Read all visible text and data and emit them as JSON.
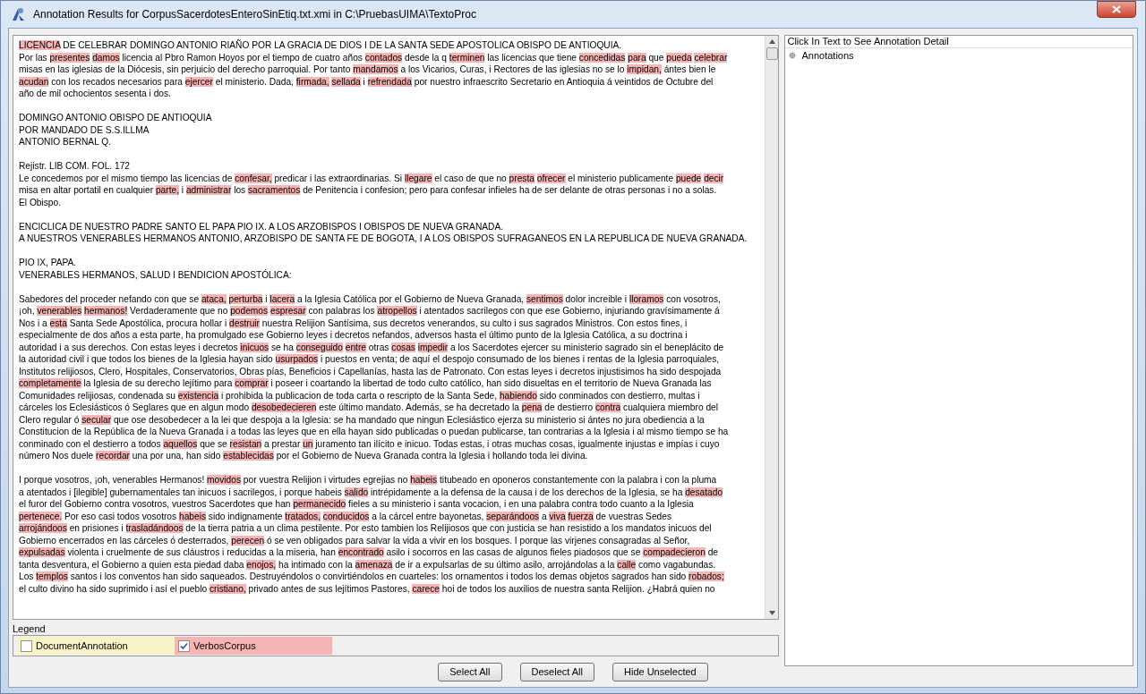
{
  "window": {
    "title": "Annotation Results for CorpusSacerdotesEnteroSinEtiq.txt.xmi in C:\\PruebasUIMA\\TextoProc"
  },
  "document": {
    "paragraphs": [
      {
        "lines": [
          [
            {
              "text": "LICENCIA",
              "annotated": true
            },
            {
              "text": " DE CELEBRAR DOMINGO ANTONIO RIAÑO POR LA GRACIA DE DIOS I DE LA SANTA SEDE APOSTOLICA OBISPO DE ANTIOQUIA.",
              "annotated": false
            }
          ],
          [
            {
              "text": "Por las ",
              "annotated": false
            },
            {
              "text": "presentes",
              "annotated": true
            },
            {
              "text": "damos",
              "annotated": true
            },
            {
              "text": " licencia al Pbro Ramon Hoyos por el tiempo de cuatro años ",
              "annotated": false
            },
            {
              "text": "contados",
              "annotated": true
            },
            {
              "text": " desde la q ",
              "annotated": false
            },
            {
              "text": "terminen",
              "annotated": true
            },
            {
              "text": " las licencias que tiene ",
              "annotated": false
            },
            {
              "text": "concedidas",
              "annotated": true
            },
            {
              "text": "para",
              "annotated": true
            },
            {
              "text": " que ",
              "annotated": false
            },
            {
              "text": "pueda",
              "annotated": true
            },
            {
              "text": "celebrar",
              "annotated": true
            }
          ],
          [
            {
              "text": "misas en las iglesias de la Diócesis, sin perjuicio del derecho parroquial. Por tanto ",
              "annotated": false
            },
            {
              "text": "mandamos",
              "annotated": true
            },
            {
              "text": " a los Vicarios, Curas, i Rectores de las iglesias no se lo ",
              "annotated": false
            },
            {
              "text": "impidan,",
              "annotated": true
            },
            {
              "text": " ántes bien le",
              "annotated": false
            }
          ],
          [
            {
              "text": "acudan",
              "annotated": true
            },
            {
              "text": " con los recados necesarios para ",
              "annotated": false
            },
            {
              "text": "ejercer",
              "annotated": true
            },
            {
              "text": " el ministerio. Dada, ",
              "annotated": false
            },
            {
              "text": "firmada,",
              "annotated": true
            },
            {
              "text": "sellada",
              "annotated": true
            },
            {
              "text": " i ",
              "annotated": false
            },
            {
              "text": "refrendada",
              "annotated": true
            },
            {
              "text": " por nuestro infraescrito Secretario en Antioquia á veintidos de Octubre del",
              "annotated": false
            }
          ],
          [
            {
              "text": "año de mil ochocientos sesenta i dos.",
              "annotated": false
            }
          ]
        ]
      },
      {
        "lines": [
          [
            {
              "text": "DOMINGO ANTONIO OBISPO DE ANTIOQUIA",
              "annotated": false
            }
          ],
          [
            {
              "text": "POR MANDADO DE S.S.ILLMA",
              "annotated": false
            }
          ],
          [
            {
              "text": "ANTONIO BERNAL Q.",
              "annotated": false
            }
          ]
        ]
      },
      {
        "lines": [
          [
            {
              "text": "Rejistr. LIB COM. FOL. 172",
              "annotated": false
            }
          ],
          [
            {
              "text": "Le concedemos por el mismo tiempo las licencias de ",
              "annotated": false
            },
            {
              "text": "confesar,",
              "annotated": true
            },
            {
              "text": " predicar i las extraordinarias. Si ",
              "annotated": false
            },
            {
              "text": "llegare",
              "annotated": true
            },
            {
              "text": " el caso de que no ",
              "annotated": false
            },
            {
              "text": "presta",
              "annotated": true
            },
            {
              "text": "ofrecer",
              "annotated": true
            },
            {
              "text": " el ministerio publicamente ",
              "annotated": false
            },
            {
              "text": "puede",
              "annotated": true
            },
            {
              "text": "decir",
              "annotated": true
            }
          ],
          [
            {
              "text": "misa en altar portatil en cualquier ",
              "annotated": false
            },
            {
              "text": "parte,",
              "annotated": true
            },
            {
              "text": " i ",
              "annotated": false
            },
            {
              "text": "administrar",
              "annotated": true
            },
            {
              "text": " los ",
              "annotated": false
            },
            {
              "text": "sacramentos",
              "annotated": true
            },
            {
              "text": " de Penitencia i confesion; pero para confesar infieles ha de ser delante de otras personas i no a solas.",
              "annotated": false
            }
          ],
          [
            {
              "text": "El Obispo.",
              "annotated": false
            }
          ]
        ]
      },
      {
        "lines": [
          [
            {
              "text": "ENCICLICA DE NUESTRO PADRE SANTO EL PAPA PIO IX. A LOS ARZOBISPOS I OBISPOS DE NUEVA GRANADA.",
              "annotated": false
            }
          ],
          [
            {
              "text": "A NUESTROS VENERABLES HERMANOS ANTONIO, ARZOBISPO DE SANTA FE DE BOGOTA, I A LOS OBISPOS SUFRAGANEOS EN LA REPUBLICA DE NUEVA GRANADA.",
              "annotated": false
            }
          ]
        ]
      },
      {
        "lines": [
          [
            {
              "text": "PIO IX, PAPA.",
              "annotated": false
            }
          ],
          [
            {
              "text": "VENERABLES HERMANOS, SALUD I BENDICION APOSTÓLICA:",
              "annotated": false
            }
          ]
        ]
      },
      {
        "lines": [
          [
            {
              "text": "Sabedores del proceder nefando con que se ",
              "annotated": false
            },
            {
              "text": "ataca,",
              "annotated": true
            },
            {
              "text": "perturba",
              "annotated": true
            },
            {
              "text": " i ",
              "annotated": false
            },
            {
              "text": "lacera",
              "annotated": true
            },
            {
              "text": " a la Iglesia Católica por el Gobierno de Nueva Granada, ",
              "annotated": false
            },
            {
              "text": "sentimos",
              "annotated": true
            },
            {
              "text": " dolor increible i ",
              "annotated": false
            },
            {
              "text": "lloramos",
              "annotated": true
            },
            {
              "text": " con vosotros,",
              "annotated": false
            }
          ],
          [
            {
              "text": "¡oh, ",
              "annotated": false
            },
            {
              "text": "venerables",
              "annotated": true
            },
            {
              "text": "hermanos!",
              "annotated": true
            },
            {
              "text": " Verdaderamente que no ",
              "annotated": false
            },
            {
              "text": "podemos",
              "annotated": true
            },
            {
              "text": "espresar",
              "annotated": true
            },
            {
              "text": " con palabras los ",
              "annotated": false
            },
            {
              "text": "atropellos",
              "annotated": true
            },
            {
              "text": " i atentados sacrilegos con que ese Gobierno, injuriando gravísimamente á",
              "annotated": false
            }
          ],
          [
            {
              "text": "Nos i a ",
              "annotated": false
            },
            {
              "text": "esta",
              "annotated": true
            },
            {
              "text": " Santa Sede Apostólica, procura hollar i ",
              "annotated": false
            },
            {
              "text": "destruir",
              "annotated": true
            },
            {
              "text": " nuestra Relijion Santísima, sus decretos venerandos, su culto i sus sagrados Ministros. Con estos fines, i",
              "annotated": false
            }
          ],
          [
            {
              "text": "especialmente de dos años a esta parte, ha promulgado ese Gobierno leyes i decretos nefandos, adversos hasta el último punto de la Iglesia Católica, a su doctrina i",
              "annotated": false
            }
          ],
          [
            {
              "text": "autoridad i a sus derechos. Con estas leyes i decretos ",
              "annotated": false
            },
            {
              "text": "inicuos",
              "annotated": true
            },
            {
              "text": " se ha ",
              "annotated": false
            },
            {
              "text": "conseguido",
              "annotated": true
            },
            {
              "text": "entre",
              "annotated": true
            },
            {
              "text": " otras ",
              "annotated": false
            },
            {
              "text": "cosas",
              "annotated": true
            },
            {
              "text": "impedir",
              "annotated": true
            },
            {
              "text": " a los Sacerdotes ejercer su ministerio sagrado sin el beneplácito de",
              "annotated": false
            }
          ],
          [
            {
              "text": "la autoridad civil i que todos los bienes de la Iglesia hayan sido ",
              "annotated": false
            },
            {
              "text": "usurpados",
              "annotated": true
            },
            {
              "text": " i puestos en venta; de aquí el despojo consumado de los bienes i rentas de la Iglesia parroquiales,",
              "annotated": false
            }
          ],
          [
            {
              "text": "Institutos relijiosos, Clero, Hospitales, Conservatorios, Obras pías, Beneficios i Capellanías, hasta las de Patronato. Con estas leyes i decretos injustisimos ha sido despojada",
              "annotated": false
            }
          ],
          [
            {
              "text": "completamente",
              "annotated": true
            },
            {
              "text": " la Iglesia de su derecho lejítimo para ",
              "annotated": false
            },
            {
              "text": "comprar",
              "annotated": true
            },
            {
              "text": " i poseer i coartando la libertad de todo culto católico, han sido disueltas en el territorio de Nueva Granada las",
              "annotated": false
            }
          ],
          [
            {
              "text": "Comunidades relijiosas, condenada su ",
              "annotated": false
            },
            {
              "text": "existencia",
              "annotated": true
            },
            {
              "text": " i prohibida la publicacion de toda carta o rescripto de la Santa Sede, ",
              "annotated": false
            },
            {
              "text": "habiendo",
              "annotated": true
            },
            {
              "text": " sido conminados con destierro, multas i",
              "annotated": false
            }
          ],
          [
            {
              "text": "cárceles los Eclesiásticos ó Seglares que en algun modo ",
              "annotated": false
            },
            {
              "text": "desobedecieren",
              "annotated": true
            },
            {
              "text": " este último mandato. Además, se ha decretado la ",
              "annotated": false
            },
            {
              "text": "pena",
              "annotated": true
            },
            {
              "text": " de destierro ",
              "annotated": false
            },
            {
              "text": "contra",
              "annotated": true
            },
            {
              "text": " cualquiera miembro del",
              "annotated": false
            }
          ],
          [
            {
              "text": "Clero regular ó ",
              "annotated": false
            },
            {
              "text": "secular",
              "annotated": true
            },
            {
              "text": " que ose desobedecer a la lei que despoja a la Iglesia: se ha mandado que ningun Eclesiástico ejerza su ministerio si ántes no jura obediencia a la",
              "annotated": false
            }
          ],
          [
            {
              "text": "Constitucion de la República de la Nueva Granada i a todas las leyes que en ella hayan sido publicadas o puedan publicarse, tan contrarias a la Iglesia i al mismo tiempo se ha",
              "annotated": false
            }
          ],
          [
            {
              "text": "conminado con el destierro a todos ",
              "annotated": false
            },
            {
              "text": "aquellos",
              "annotated": true
            },
            {
              "text": " que se ",
              "annotated": false
            },
            {
              "text": "resistan",
              "annotated": true
            },
            {
              "text": " a prestar ",
              "annotated": false
            },
            {
              "text": "un",
              "annotated": true
            },
            {
              "text": " juramento tan ilícito e inicuo. Todas estas, i otras muchas cosas, igualmente injustas e impías i cuyo",
              "annotated": false
            }
          ],
          [
            {
              "text": "número Nos duele ",
              "annotated": false
            },
            {
              "text": "recordar",
              "annotated": true
            },
            {
              "text": " una por una, han sido ",
              "annotated": false
            },
            {
              "text": "establecidas",
              "annotated": true
            },
            {
              "text": " por el Gobierno de Nueva Granada contra la Iglesia i hollando toda lei divina.",
              "annotated": false
            }
          ]
        ]
      },
      {
        "lines": [
          [
            {
              "text": "I porque vosotros, ¡oh, venerables Hermanos! ",
              "annotated": false
            },
            {
              "text": "movidos",
              "annotated": true
            },
            {
              "text": " por vuestra Relijion i virtudes egrejias no ",
              "annotated": false
            },
            {
              "text": "habeis",
              "annotated": true
            },
            {
              "text": " titubeado en oponeros constantemente con la palabra i con la pluma",
              "annotated": false
            }
          ],
          [
            {
              "text": "a atentados i [ilegible] gubernamentales tan inicuos i sacrilegos, i porque habeis ",
              "annotated": false
            },
            {
              "text": "salido",
              "annotated": true
            },
            {
              "text": " intrépidamente a la defensa de la causa i de los derechos de la Iglesia, se ha ",
              "annotated": false
            },
            {
              "text": "desatado",
              "annotated": true
            }
          ],
          [
            {
              "text": "el furor del Gobierno contra vosotros, vuestros Sacerdotes que han ",
              "annotated": false
            },
            {
              "text": "permanecido",
              "annotated": true
            },
            {
              "text": " fieles a su ministerio i santa vocacion, i en una palabra contra todo cuanto a la Iglesia",
              "annotated": false
            }
          ],
          [
            {
              "text": "pertenece.",
              "annotated": true
            },
            {
              "text": " Por eso casi todos vosotros ",
              "annotated": false
            },
            {
              "text": "habeis",
              "annotated": true
            },
            {
              "text": " sido indignamente ",
              "annotated": false
            },
            {
              "text": "tratados,",
              "annotated": true
            },
            {
              "text": "conducidos",
              "annotated": true
            },
            {
              "text": " a la cárcel entre bayonetas, ",
              "annotated": false
            },
            {
              "text": "separándoos",
              "annotated": true
            },
            {
              "text": " a ",
              "annotated": false
            },
            {
              "text": "viva",
              "annotated": true
            },
            {
              "text": "fuerza",
              "annotated": true
            },
            {
              "text": " de vuestras Sedes",
              "annotated": false
            }
          ],
          [
            {
              "text": "arrojándoos",
              "annotated": true
            },
            {
              "text": " en prisiones i ",
              "annotated": false
            },
            {
              "text": "trasladándoos",
              "annotated": true
            },
            {
              "text": " de la tierra patria a un clima pestilente. Por esto tambien los Relijiosos que con justicia se han resistido a los mandatos inicuos del",
              "annotated": false
            }
          ],
          [
            {
              "text": "Gobierno encerrados en las cárceles ó desterrados, ",
              "annotated": false
            },
            {
              "text": "perecen",
              "annotated": true
            },
            {
              "text": " ó se ven obligados para salvar la vida a vivir en los bosques. I porque las virjenes consagradas al Señor,",
              "annotated": false
            }
          ],
          [
            {
              "text": "expulsadas",
              "annotated": true
            },
            {
              "text": " violenta i cruelmente de sus cláustros i reducidas a la miseria, han ",
              "annotated": false
            },
            {
              "text": "encontrado",
              "annotated": true
            },
            {
              "text": " asilo i socorros en las casas de algunos fieles piadosos que se ",
              "annotated": false
            },
            {
              "text": "compadecieron",
              "annotated": true
            },
            {
              "text": " de",
              "annotated": false
            }
          ],
          [
            {
              "text": "tanta desventura, el Gobierno a quien esta piedad daba ",
              "annotated": false
            },
            {
              "text": "enojos,",
              "annotated": true
            },
            {
              "text": " ha intimado con la ",
              "annotated": false
            },
            {
              "text": "amenaza",
              "annotated": true
            },
            {
              "text": " de ir a expulsarlas de su último asilo, arrojándolas a la ",
              "annotated": false
            },
            {
              "text": "calle",
              "annotated": true
            },
            {
              "text": " como vagabundas.",
              "annotated": false
            }
          ],
          [
            {
              "text": "Los ",
              "annotated": false
            },
            {
              "text": "templos",
              "annotated": true
            },
            {
              "text": " santos i los conventos han sido saqueados. Destruyéndolos o convirtiéndolos en cuarteles: los ornamentos i todos los demas objetos sagrados han sido ",
              "annotated": false
            },
            {
              "text": "robados;",
              "annotated": true
            }
          ],
          [
            {
              "text": "el culto divino ha sido suprimido i así el pueblo ",
              "annotated": false
            },
            {
              "text": "cristiano,",
              "annotated": true
            },
            {
              "text": " privado antes de sus lejítimos Pastores, ",
              "annotated": false
            },
            {
              "text": "carece",
              "annotated": true
            },
            {
              "text": " hoi de todos los auxilios de nuestra santa Relijion. ¿Habrá quien no",
              "annotated": false
            }
          ]
        ]
      }
    ]
  },
  "detail_panel": {
    "header": "Click In Text to See Annotation Detail",
    "tree": [
      {
        "label": "Annotations"
      }
    ]
  },
  "legend": {
    "title": "Legend",
    "items": [
      {
        "label": "DocumentAnnotation",
        "checked": false,
        "color": "#f7f3c6"
      },
      {
        "label": "VerbosCorpus",
        "checked": true,
        "color": "#f5b5b5"
      }
    ]
  },
  "buttons": [
    "Select All",
    "Deselect All",
    "Hide Unselected"
  ]
}
